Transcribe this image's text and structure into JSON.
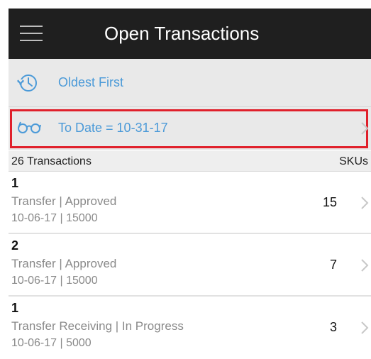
{
  "header": {
    "title": "Open Transactions",
    "menu_icon": "hamburger-menu-icon"
  },
  "sort": {
    "icon": "history-clock-icon",
    "label": "Oldest First"
  },
  "filter": {
    "icon": "glasses-icon",
    "label": "To Date = 10-31-17",
    "highlight_color": "#e0202b"
  },
  "list": {
    "count_label": "26 Transactions",
    "skus_label": "SKUs",
    "rows": [
      {
        "id": "1",
        "desc": "Transfer | Approved",
        "meta": "10-06-17 | 15000",
        "skus": "15"
      },
      {
        "id": "2",
        "desc": "Transfer | Approved",
        "meta": "10-06-17 | 15000",
        "skus": "7"
      },
      {
        "id": "1",
        "desc": "Transfer Receiving | In Progress",
        "meta": "10-06-17 | 5000",
        "skus": "3"
      }
    ]
  },
  "colors": {
    "header_bg": "#1f1f1f",
    "accent": "#4b9ad8",
    "secondary_text": "#8a8a8a"
  }
}
